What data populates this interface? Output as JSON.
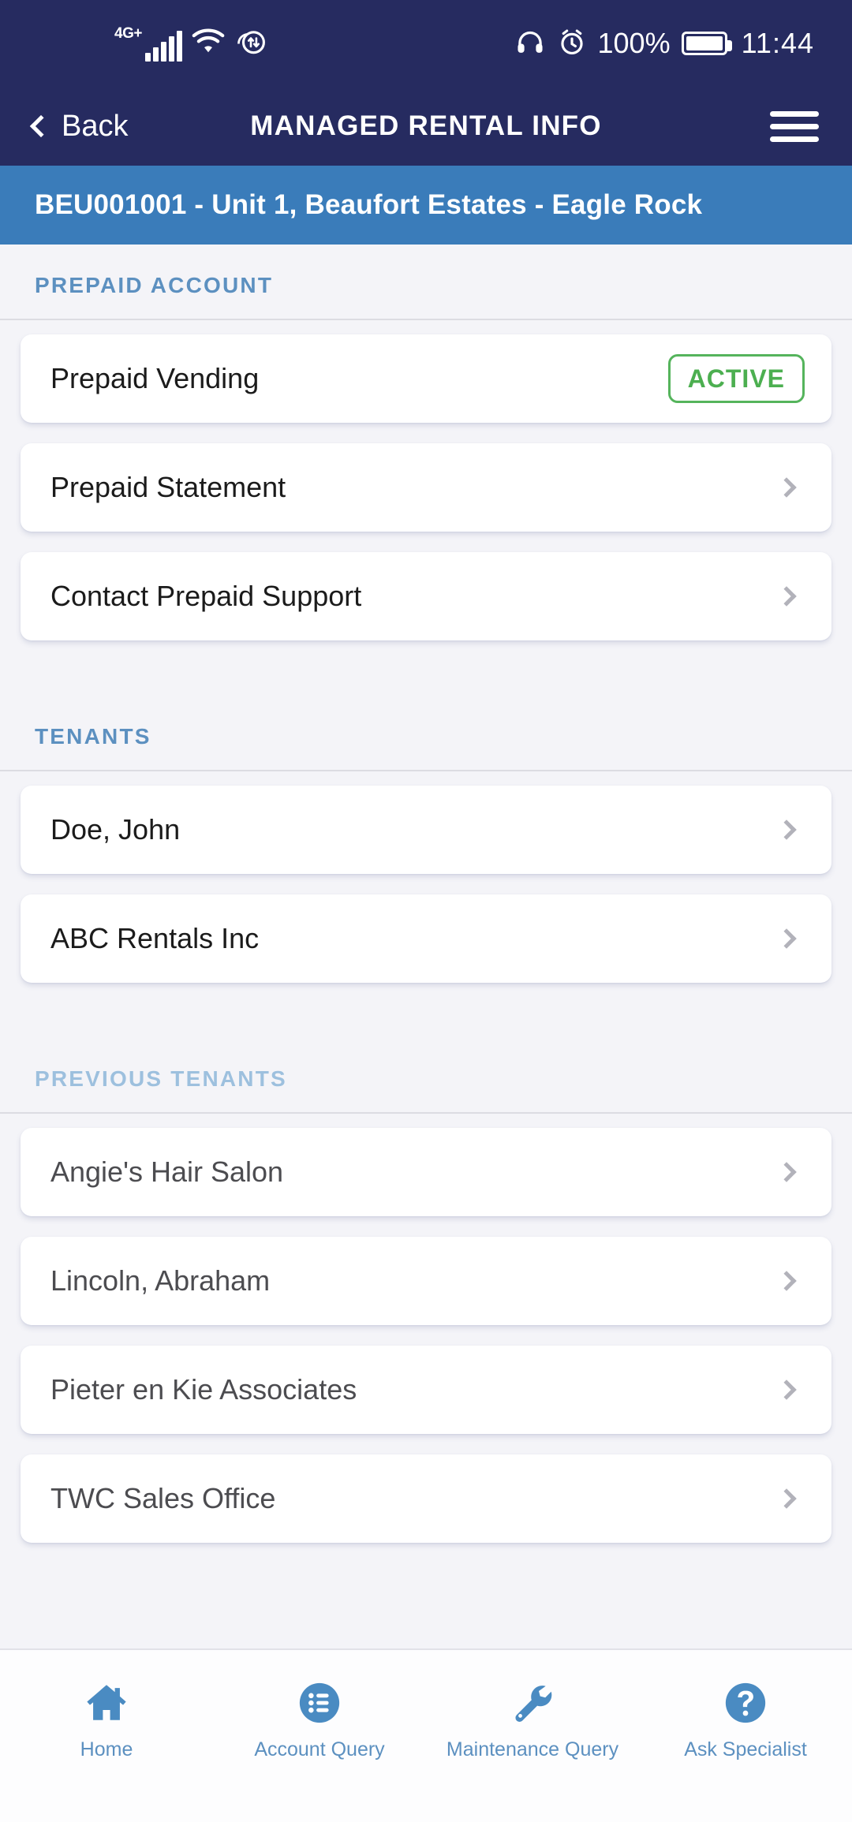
{
  "status_bar": {
    "network_type": "4G+",
    "signal_icon": "signal-bars-icon",
    "wifi_icon": "wifi-icon",
    "data_transfer_icon": "data-transfer-icon",
    "headset_icon": "headset-icon",
    "alarm_icon": "alarm-clock-icon",
    "battery_percent": "100%",
    "battery_icon": "battery-full-icon",
    "time": "11:44"
  },
  "nav": {
    "back_label": "Back",
    "back_icon": "chevron-left-icon",
    "title": "MANAGED RENTAL INFO",
    "menu_icon": "hamburger-menu-icon"
  },
  "subheader": {
    "text": "BEU001001 - Unit 1, Beaufort Estates - Eagle Rock"
  },
  "sections": [
    {
      "title": "PREPAID ACCOUNT",
      "faded": false,
      "rows": [
        {
          "label": "Prepaid Vending",
          "accessory": "badge",
          "badge": "ACTIVE"
        },
        {
          "label": "Prepaid Statement",
          "accessory": "chevron"
        },
        {
          "label": "Contact Prepaid Support",
          "accessory": "chevron"
        }
      ]
    },
    {
      "title": "TENANTS",
      "faded": false,
      "rows": [
        {
          "label": "Doe, John",
          "accessory": "chevron"
        },
        {
          "label": "ABC Rentals Inc",
          "accessory": "chevron"
        }
      ]
    },
    {
      "title": "PREVIOUS TENANTS",
      "faded": true,
      "rows": [
        {
          "label": "Angie's Hair Salon",
          "accessory": "chevron"
        },
        {
          "label": "Lincoln, Abraham",
          "accessory": "chevron"
        },
        {
          "label": "Pieter en Kie Associates",
          "accessory": "chevron"
        },
        {
          "label": "TWC Sales Office",
          "accessory": "chevron"
        }
      ]
    }
  ],
  "tabbar": [
    {
      "label": "Home",
      "icon": "home-icon"
    },
    {
      "label": "Account Query",
      "icon": "list-circle-icon"
    },
    {
      "label": "Maintenance Query",
      "icon": "wrench-icon"
    },
    {
      "label": "Ask Specialist",
      "icon": "question-circle-icon"
    }
  ],
  "colors": {
    "header_navy": "#262b60",
    "subheader_blue": "#3a7cba",
    "accent_blue": "#5c90c0",
    "badge_green": "#4caf50",
    "page_background": "#f4f4f8",
    "card_white": "#ffffff"
  }
}
